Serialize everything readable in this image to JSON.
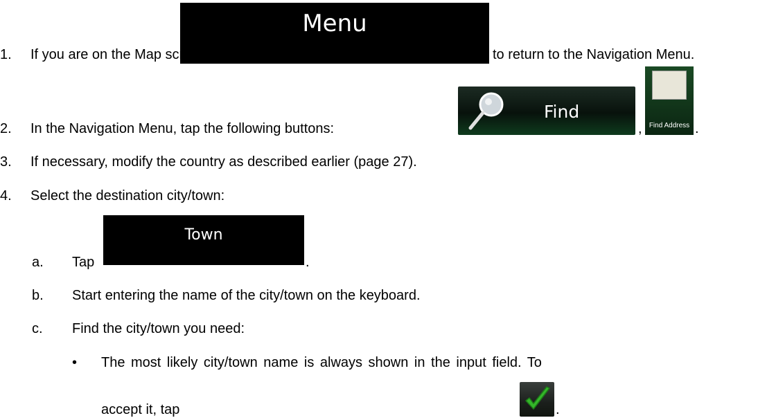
{
  "steps": {
    "s1": {
      "num": "1.",
      "pre": "If you are on the Map screen, tap",
      "button": "Menu",
      "post": "to return to the Navigation Menu."
    },
    "s2": {
      "num": "2.",
      "pre": "In the Navigation Menu, tap the following buttons:",
      "button1": "Find",
      "sep": ",",
      "button2": "Find Address",
      "end": "."
    },
    "s3": {
      "num": "3.",
      "text": "If necessary, modify the country as described earlier (page 27)."
    },
    "s4": {
      "num": "4.",
      "text": "Select the destination city/town:",
      "a": {
        "letter": "a.",
        "pre": "Tap",
        "button": "Town",
        "end": "."
      },
      "b": {
        "letter": "b.",
        "text": "Start entering the name of the city/town on the keyboard."
      },
      "c": {
        "letter": "c.",
        "text": "Find the city/town you need:"
      },
      "bullet": {
        "symbol": "•",
        "line1": "The most likely city/town name is always shown in the input field. To",
        "line2": "accept it, tap",
        "end": "."
      }
    }
  },
  "icons": {
    "find": "magnifier-icon",
    "address": "envelope-icon",
    "accept": "checkmark-icon"
  },
  "colors": {
    "button_bg": "#000000",
    "find_green": "#0e3b1d",
    "check_green": "#34b52a"
  }
}
